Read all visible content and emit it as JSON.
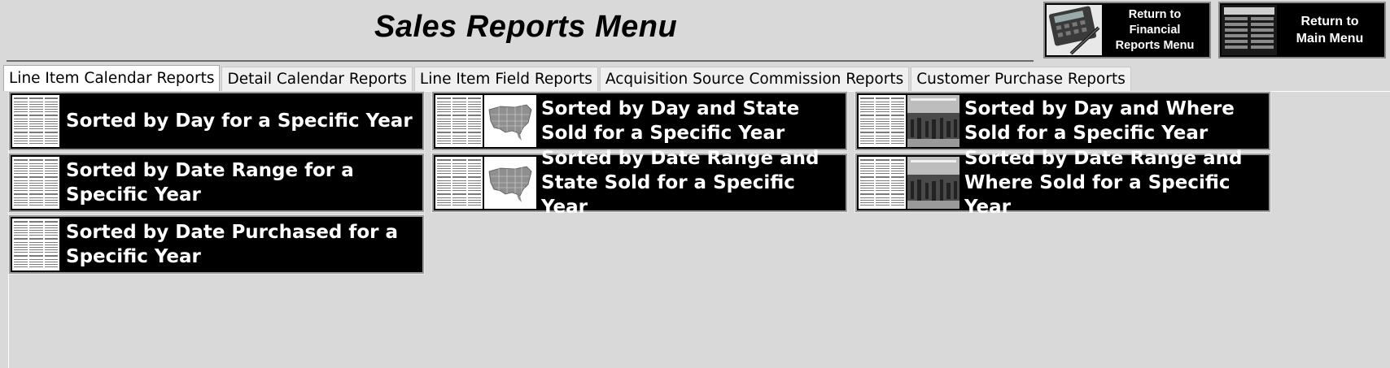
{
  "header": {
    "title": "Sales Reports Menu",
    "buttons": [
      {
        "label": "Return to\nFinancial\nReports Menu"
      },
      {
        "label": "Return to\nMain Menu"
      }
    ]
  },
  "tabs": [
    {
      "label": "Line Item Calendar Reports",
      "active": true
    },
    {
      "label": "Detail Calendar Reports"
    },
    {
      "label": "Line Item Field Reports"
    },
    {
      "label": "Acquisition Source Commission Reports"
    },
    {
      "label": "Customer Purchase Reports"
    }
  ],
  "reports": [
    {
      "label": "Sorted by Day for a Specific Year",
      "icons": [
        "calendar-icon"
      ]
    },
    {
      "label": "Sorted by Day and State Sold for a Specific Year",
      "icons": [
        "calendar-icon",
        "us-map-icon"
      ]
    },
    {
      "label": "Sorted by Day and Where Sold for a Specific Year",
      "icons": [
        "calendar-icon",
        "crowd-photo-icon"
      ]
    },
    {
      "label": "Sorted by Date Range for a Specific Year",
      "icons": [
        "calendar-icon"
      ]
    },
    {
      "label": "Sorted by Date Range and State Sold for a Specific Year",
      "icons": [
        "calendar-icon",
        "us-map-icon"
      ]
    },
    {
      "label": "Sorted by Date Range and Where Sold for a Specific Year",
      "icons": [
        "calendar-icon",
        "crowd-photo-icon"
      ]
    },
    {
      "label": "Sorted by Date Purchased for a Specific Year",
      "icons": [
        "calendar-icon"
      ]
    }
  ],
  "colors": {
    "background": "#d9d9d9",
    "button": "#000000",
    "button_text": "#ffffff"
  }
}
